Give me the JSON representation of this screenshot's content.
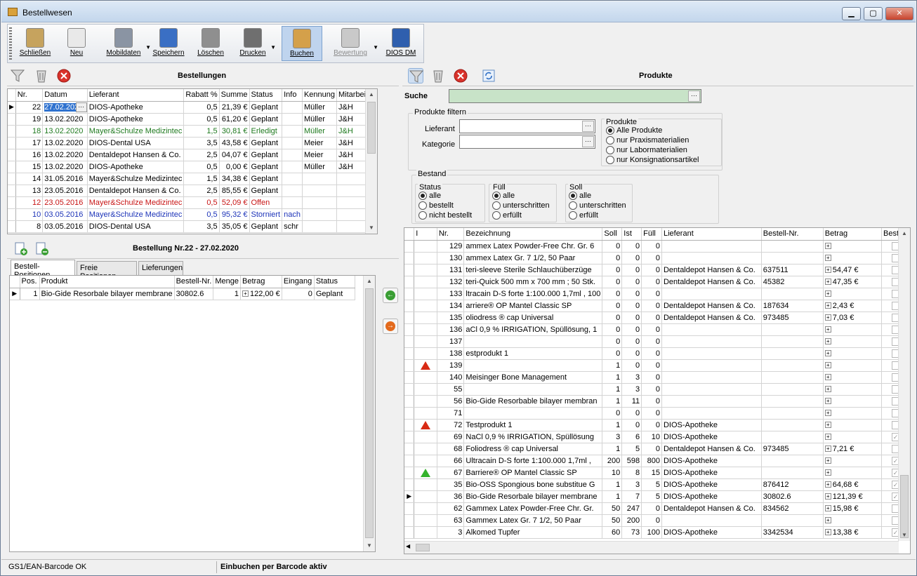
{
  "window": {
    "title": "Bestellwesen",
    "min": "▁",
    "max": "▢",
    "close": "✕"
  },
  "toolbar": [
    {
      "label": "Schließen",
      "icon": "door-exit-icon",
      "color": "#c6a35e",
      "disabled": false,
      "active": false,
      "arrow": false
    },
    {
      "label": "Neu",
      "icon": "new-document-icon",
      "color": "#e9e9e9",
      "disabled": false,
      "active": false,
      "arrow": false
    },
    {
      "label": "Mobildaten",
      "icon": "mobile-device-icon",
      "color": "#8a94a3",
      "disabled": false,
      "active": false,
      "arrow": true
    },
    {
      "label": "Speichern",
      "icon": "save-disk-icon",
      "color": "#3a6fc4",
      "disabled": false,
      "active": false,
      "arrow": false
    },
    {
      "label": "Löschen",
      "icon": "trash-icon",
      "color": "#8f8f8f",
      "disabled": false,
      "active": false,
      "arrow": false
    },
    {
      "label": "Drucken",
      "icon": "printer-icon",
      "color": "#6f6f6f",
      "disabled": false,
      "active": false,
      "arrow": true
    },
    {
      "label": "Buchen",
      "icon": "book-box-icon",
      "color": "#d4a04a",
      "disabled": false,
      "active": true,
      "arrow": false
    },
    {
      "label": "Bewertung",
      "icon": "rating-chart-icon",
      "color": "#c9c9c9",
      "disabled": true,
      "active": false,
      "arrow": true
    },
    {
      "label": "DIOS DM",
      "icon": "qm-document-icon",
      "color": "#2f5fae",
      "disabled": false,
      "active": false,
      "arrow": false
    }
  ],
  "orders": {
    "title": "Bestellungen",
    "columns": [
      "Nr.",
      "Datum",
      "Lieferant",
      "Rabatt %",
      "Summe",
      "Status",
      "Info",
      "Kennung",
      "Mitarbeiter"
    ],
    "rows": [
      {
        "nr": "22",
        "datum": "27.02.2020",
        "lieferant": "DIOS-Apotheke",
        "rabatt": "0,5",
        "summe": "21,39 €",
        "status": "Geplant",
        "info": "",
        "kennung": "Müller",
        "mitarbeiter": "J&H",
        "color": "",
        "current": true
      },
      {
        "nr": "19",
        "datum": "13.02.2020",
        "lieferant": "DIOS-Apotheke",
        "rabatt": "0,5",
        "summe": "61,20 €",
        "status": "Geplant",
        "info": "",
        "kennung": "Müller",
        "mitarbeiter": "J&H",
        "color": "",
        "current": false
      },
      {
        "nr": "18",
        "datum": "13.02.2020",
        "lieferant": "Mayer&Schulze Medizintec",
        "rabatt": "1,5",
        "summe": "30,81 €",
        "status": "Erledigt",
        "info": "",
        "kennung": "Müller",
        "mitarbeiter": "J&H",
        "color": "green",
        "current": false
      },
      {
        "nr": "17",
        "datum": "13.02.2020",
        "lieferant": "DIOS-Dental USA",
        "rabatt": "3,5",
        "summe": "43,58 €",
        "status": "Geplant",
        "info": "",
        "kennung": "Meier",
        "mitarbeiter": "J&H",
        "color": "",
        "current": false
      },
      {
        "nr": "16",
        "datum": "13.02.2020",
        "lieferant": "Dentaldepot Hansen & Co.",
        "rabatt": "2,5",
        "summe": "04,07 €",
        "status": "Geplant",
        "info": "",
        "kennung": "Meier",
        "mitarbeiter": "J&H",
        "color": "",
        "current": false
      },
      {
        "nr": "15",
        "datum": "13.02.2020",
        "lieferant": "DIOS-Apotheke",
        "rabatt": "0,5",
        "summe": "0,00 €",
        "status": "Geplant",
        "info": "",
        "kennung": "Müller",
        "mitarbeiter": "J&H",
        "color": "",
        "current": false
      },
      {
        "nr": "14",
        "datum": "31.05.2016",
        "lieferant": "Mayer&Schulze Medizintec",
        "rabatt": "1,5",
        "summe": "34,38 €",
        "status": "Geplant",
        "info": "",
        "kennung": "",
        "mitarbeiter": "",
        "color": "",
        "current": false
      },
      {
        "nr": "13",
        "datum": "23.05.2016",
        "lieferant": "Dentaldepot Hansen & Co.",
        "rabatt": "2,5",
        "summe": "85,55 €",
        "status": "Geplant",
        "info": "",
        "kennung": "",
        "mitarbeiter": "",
        "color": "",
        "current": false
      },
      {
        "nr": "12",
        "datum": "23.05.2016",
        "lieferant": "Mayer&Schulze Medizintec",
        "rabatt": "0,5",
        "summe": "52,09 €",
        "status": "Offen",
        "info": "",
        "kennung": "",
        "mitarbeiter": "",
        "color": "red",
        "current": false
      },
      {
        "nr": "10",
        "datum": "03.05.2016",
        "lieferant": "Mayer&Schulze Medizintec",
        "rabatt": "0,5",
        "summe": "95,32 €",
        "status": "Storniert",
        "info": "nach",
        "kennung": "",
        "mitarbeiter": "",
        "color": "blue",
        "current": false
      },
      {
        "nr": "8",
        "datum": "03.05.2016",
        "lieferant": "DIOS-Dental USA",
        "rabatt": "3,5",
        "summe": "35,05 €",
        "status": "Geplant",
        "info": "schr",
        "kennung": "",
        "mitarbeiter": "",
        "color": "",
        "current": false
      }
    ]
  },
  "order_detail": {
    "title": "Bestellung Nr.22 - 27.02.2020",
    "tabs": [
      "Bestell-Positionen",
      "Freie Positionen",
      "Lieferungen"
    ],
    "columns": [
      "Pos.",
      "Produkt",
      "Bestell-Nr.",
      "Menge",
      "Betrag",
      "Eingang",
      "Status"
    ],
    "rows": [
      {
        "pos": "1",
        "produkt": "Bio-Gide Resorbale bilayer membrane",
        "bestellnr": "30802.6",
        "menge": "1",
        "betrag": "122,00 €",
        "eingang": "0",
        "status": "Geplant"
      }
    ]
  },
  "products": {
    "title": "Produkte",
    "search_label": "Suche",
    "search_value": "",
    "filter_legend": "Produkte filtern",
    "lieferant_label": "Lieferant",
    "kategorie_label": "Kategorie",
    "produkte_legend": "Produkte",
    "produkte_options": [
      "Alle Produkte",
      "nur Praxismaterialien",
      "nur Labormaterialien",
      "nur Konsignationsartikel"
    ],
    "bestand_legend": "Bestand",
    "status_legend": "Status",
    "status_options": [
      "alle",
      "bestellt",
      "nicht bestellt"
    ],
    "fuell_legend": "Füll",
    "fuell_options": [
      "alle",
      "unterschritten",
      "erfüllt"
    ],
    "soll_legend": "Soll",
    "soll_options": [
      "alle",
      "unterschritten",
      "erfüllt"
    ],
    "columns": [
      "I",
      "Nr.",
      "Bezeichnung",
      "Soll",
      "Ist",
      "Füll",
      "Lieferant",
      "Bestell-Nr.",
      "Betrag",
      "Bestell"
    ],
    "rows": [
      {
        "warn": "",
        "nr": "129",
        "bez": "ammex Latex Powder-Free Chr. Gr. 6",
        "soll": "0",
        "ist": "0",
        "fuell": "0",
        "lief": "",
        "bnr": "",
        "betrag": "",
        "checked": false,
        "current": false
      },
      {
        "warn": "",
        "nr": "130",
        "bez": "ammex Latex Gr. 7 1/2, 50 Paar",
        "soll": "0",
        "ist": "0",
        "fuell": "0",
        "lief": "",
        "bnr": "",
        "betrag": "",
        "checked": false,
        "current": false
      },
      {
        "warn": "",
        "nr": "131",
        "bez": "teri-sleeve Sterile Schlauchüberzüge",
        "soll": "0",
        "ist": "0",
        "fuell": "0",
        "lief": "Dentaldepot Hansen & Co.",
        "bnr": "637511",
        "betrag": "54,47 €",
        "checked": false,
        "current": false
      },
      {
        "warn": "",
        "nr": "132",
        "bez": "teri-Quick 500 mm x 700 mm ; 50 Stk.",
        "soll": "0",
        "ist": "0",
        "fuell": "0",
        "lief": "Dentaldepot Hansen & Co.",
        "bnr": "45382",
        "betrag": "47,35 €",
        "checked": false,
        "current": false
      },
      {
        "warn": "",
        "nr": "133",
        "bez": "ltracain D-S forte 1:100.000 1,7ml , 100",
        "soll": "0",
        "ist": "0",
        "fuell": "0",
        "lief": "",
        "bnr": "",
        "betrag": "",
        "checked": false,
        "current": false
      },
      {
        "warn": "",
        "nr": "134",
        "bez": "arriere® OP Mantel Classic SP",
        "soll": "0",
        "ist": "0",
        "fuell": "0",
        "lief": "Dentaldepot Hansen & Co.",
        "bnr": "187634",
        "betrag": "2,43 €",
        "checked": false,
        "current": false
      },
      {
        "warn": "",
        "nr": "135",
        "bez": "oliodress ® cap Universal",
        "soll": "0",
        "ist": "0",
        "fuell": "0",
        "lief": "Dentaldepot Hansen & Co.",
        "bnr": "973485",
        "betrag": "7,03 €",
        "checked": false,
        "current": false
      },
      {
        "warn": "",
        "nr": "136",
        "bez": "aCl 0,9 % IRRIGATION, Spüllösung, 1",
        "soll": "0",
        "ist": "0",
        "fuell": "0",
        "lief": "",
        "bnr": "",
        "betrag": "",
        "checked": false,
        "current": false
      },
      {
        "warn": "",
        "nr": "137",
        "bez": "",
        "soll": "0",
        "ist": "0",
        "fuell": "0",
        "lief": "",
        "bnr": "",
        "betrag": "",
        "checked": false,
        "current": false
      },
      {
        "warn": "",
        "nr": "138",
        "bez": "estprodukt 1",
        "soll": "0",
        "ist": "0",
        "fuell": "0",
        "lief": "",
        "bnr": "",
        "betrag": "",
        "checked": false,
        "current": false
      },
      {
        "warn": "red",
        "nr": "139",
        "bez": "",
        "soll": "1",
        "ist": "0",
        "fuell": "0",
        "lief": "",
        "bnr": "",
        "betrag": "",
        "checked": false,
        "current": false
      },
      {
        "warn": "",
        "nr": "140",
        "bez": "Meisinger Bone Management",
        "soll": "1",
        "ist": "3",
        "fuell": "0",
        "lief": "",
        "bnr": "",
        "betrag": "",
        "checked": false,
        "current": false
      },
      {
        "warn": "",
        "nr": "55",
        "bez": "",
        "soll": "1",
        "ist": "3",
        "fuell": "0",
        "lief": "",
        "bnr": "",
        "betrag": "",
        "checked": false,
        "current": false
      },
      {
        "warn": "",
        "nr": "56",
        "bez": "Bio-Gide Resorbable bilayer membran",
        "soll": "1",
        "ist": "11",
        "fuell": "0",
        "lief": "",
        "bnr": "",
        "betrag": "",
        "checked": false,
        "current": false
      },
      {
        "warn": "",
        "nr": "71",
        "bez": "",
        "soll": "0",
        "ist": "0",
        "fuell": "0",
        "lief": "",
        "bnr": "",
        "betrag": "",
        "checked": false,
        "current": false
      },
      {
        "warn": "red",
        "nr": "72",
        "bez": "Testprodukt 1",
        "soll": "1",
        "ist": "0",
        "fuell": "0",
        "lief": "DIOS-Apotheke",
        "bnr": "",
        "betrag": "",
        "checked": false,
        "current": false
      },
      {
        "warn": "",
        "nr": "69",
        "bez": "NaCl 0,9 % IRRIGATION, Spüllösung",
        "soll": "3",
        "ist": "6",
        "fuell": "10",
        "lief": "DIOS-Apotheke",
        "bnr": "",
        "betrag": "",
        "checked": true,
        "current": false
      },
      {
        "warn": "",
        "nr": "68",
        "bez": "Foliodress ® cap Universal",
        "soll": "1",
        "ist": "5",
        "fuell": "0",
        "lief": "Dentaldepot Hansen & Co.",
        "bnr": "973485",
        "betrag": "7,21 €",
        "checked": false,
        "current": false
      },
      {
        "warn": "",
        "nr": "66",
        "bez": "Ultracain D-S forte 1:100.000 1,7ml ,",
        "soll": "200",
        "ist": "598",
        "fuell": "800",
        "lief": "DIOS-Apotheke",
        "bnr": "",
        "betrag": "",
        "checked": true,
        "current": false
      },
      {
        "warn": "green",
        "nr": "67",
        "bez": "Barriere® OP Mantel Classic SP",
        "soll": "10",
        "ist": "8",
        "fuell": "15",
        "lief": "DIOS-Apotheke",
        "bnr": "",
        "betrag": "",
        "checked": true,
        "current": false
      },
      {
        "warn": "",
        "nr": "35",
        "bez": "Bio-OSS Spongious bone substitue G",
        "soll": "1",
        "ist": "3",
        "fuell": "5",
        "lief": "DIOS-Apotheke",
        "bnr": "876412",
        "betrag": "64,68 €",
        "checked": true,
        "current": false
      },
      {
        "warn": "",
        "nr": "36",
        "bez": "Bio-Gide Resorbale bilayer membrane",
        "soll": "1",
        "ist": "7",
        "fuell": "5",
        "lief": "DIOS-Apotheke",
        "bnr": "30802.6",
        "betrag": "121,39 €",
        "checked": true,
        "current": true
      },
      {
        "warn": "",
        "nr": "62",
        "bez": "Gammex Latex Powder-Free Chr. Gr.",
        "soll": "50",
        "ist": "247",
        "fuell": "0",
        "lief": "Dentaldepot Hansen & Co.",
        "bnr": "834562",
        "betrag": "15,98 €",
        "checked": false,
        "current": false
      },
      {
        "warn": "",
        "nr": "63",
        "bez": "Gammex Latex Gr. 7 1/2, 50 Paar",
        "soll": "50",
        "ist": "200",
        "fuell": "0",
        "lief": "",
        "bnr": "",
        "betrag": "",
        "checked": false,
        "current": false
      },
      {
        "warn": "",
        "nr": "3",
        "bez": "Alkomed Tupfer",
        "soll": "60",
        "ist": "73",
        "fuell": "100",
        "lief": "DIOS-Apotheke",
        "bnr": "3342534",
        "betrag": "13,38 €",
        "checked": true,
        "current": false
      }
    ]
  },
  "status": {
    "left": "GS1/EAN-Barcode OK",
    "right": "Einbuchen per Barcode aktiv"
  }
}
